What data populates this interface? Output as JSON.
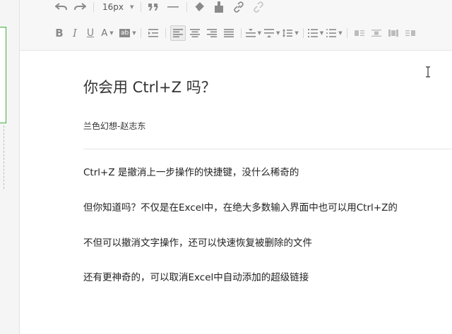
{
  "toolbar": {
    "font_size": "16px",
    "buttons_row1": [
      "undo-icon",
      "redo-icon",
      "font-size",
      "blockquote-icon",
      "horizontal-rule-icon",
      "eraser-icon",
      "format-brush-icon",
      "link-icon",
      "unlink-icon"
    ],
    "buttons_row2": [
      "bold-icon",
      "italic-icon",
      "underline-icon",
      "font-color-icon",
      "background-color-icon",
      "indent-icon",
      "align-left-icon",
      "align-center-icon",
      "align-right-icon",
      "align-justify-icon",
      "paragraph-spacing-before-icon",
      "paragraph-spacing-after-icon",
      "line-height-icon",
      "ordered-list-icon",
      "unordered-list-icon",
      "image-left-icon",
      "image-inline-icon",
      "image-center-icon",
      "image-right-icon"
    ],
    "bold_label": "B",
    "italic_label": "I",
    "underline_label": "U",
    "font_color_label": "A",
    "background_color_label": "ab"
  },
  "article": {
    "title": "你会用 Ctrl+Z 吗？",
    "author": "兰色幻想-赵志东",
    "paragraphs": [
      "Ctrl+Z 是撤消上一步操作的快捷键，没什么稀奇的",
      "但你知道吗？不仅是在Excel中，在绝大多数输入界面中也可以用Ctrl+Z的",
      "不但可以撤消文字操作，还可以快速恢复被删除的文件",
      "还有更神奇的，可以取消Excel中自动添加的超级链接"
    ]
  },
  "colors": {
    "selected_border": "#3fae3f",
    "toolbar_icon": "#8a8a8a",
    "text": "#222222"
  }
}
